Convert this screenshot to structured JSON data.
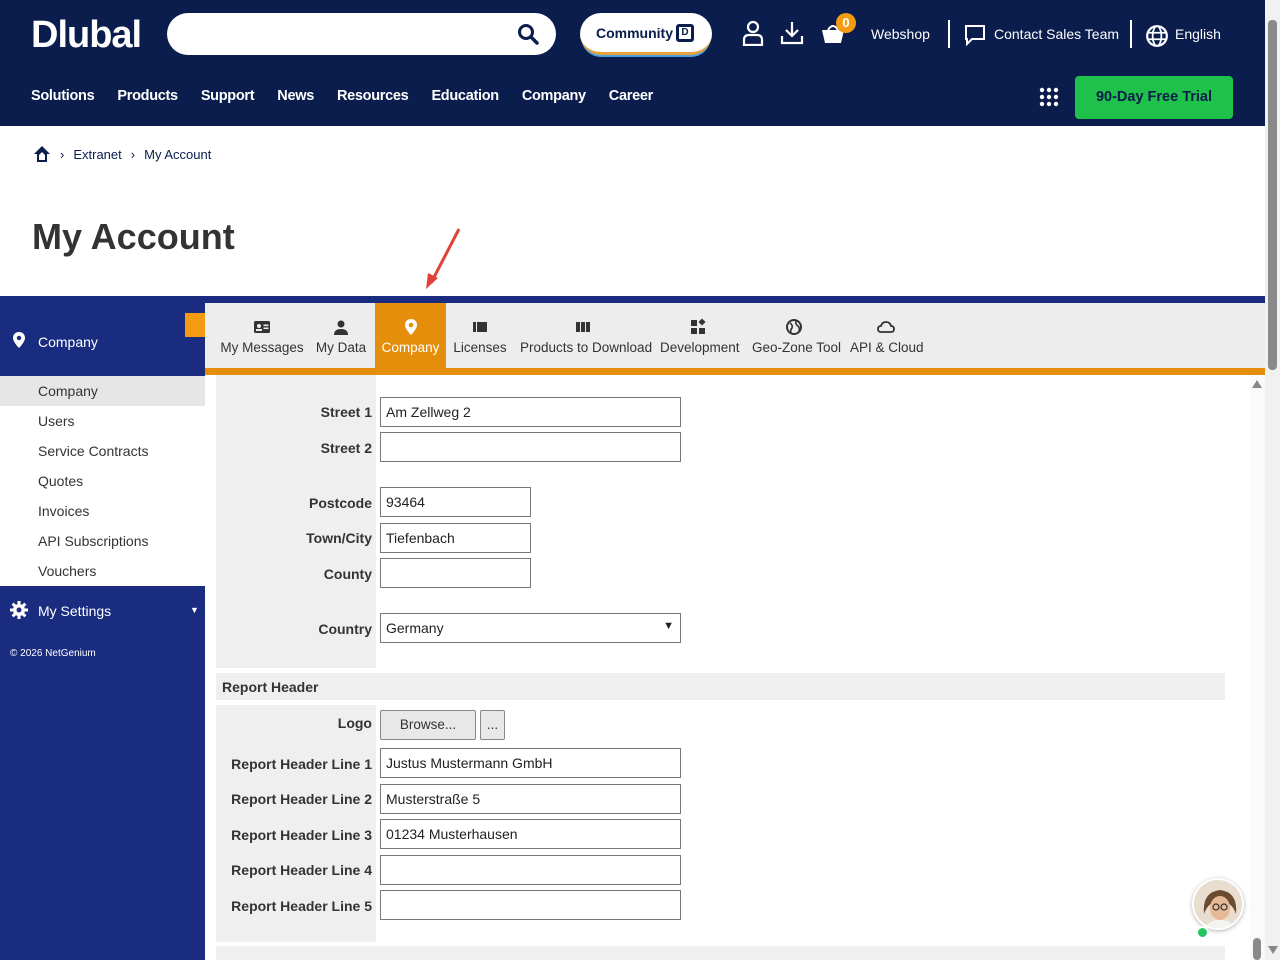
{
  "header": {
    "logo": "Dlubal",
    "search_placeholder": "",
    "community_label": "Community",
    "cart_count": "0",
    "webshop_label": "Webshop",
    "contact_label": "Contact Sales Team",
    "language_label": "English",
    "nav": [
      "Solutions",
      "Products",
      "Support",
      "News",
      "Resources",
      "Education",
      "Company",
      "Career"
    ],
    "trial_button": "90-Day Free Trial",
    "colors": {
      "header_bg": "#0b1d4d",
      "trial_bg": "#1ec24a",
      "accent": "#e58e0b"
    }
  },
  "breadcrumb": {
    "items": [
      "Extranet",
      "My Account"
    ]
  },
  "page_title": "My Account",
  "sidebar": {
    "section_title": "Company",
    "items": [
      {
        "label": "Company"
      },
      {
        "label": "Users"
      },
      {
        "label": "Service Contracts"
      },
      {
        "label": "Quotes"
      },
      {
        "label": "Invoices"
      },
      {
        "label": "API Subscriptions"
      },
      {
        "label": "Vouchers"
      }
    ],
    "settings_label": "My Settings",
    "copyright": "© 2026 NetGenium"
  },
  "tabs": [
    {
      "label": "My Messages",
      "icon": "id-card-icon"
    },
    {
      "label": "My Data",
      "icon": "user-icon"
    },
    {
      "label": "Company",
      "icon": "location-pin-icon"
    },
    {
      "label": "Licenses",
      "icon": "license-icon"
    },
    {
      "label": "Products to Download",
      "icon": "columns-icon"
    },
    {
      "label": "Development",
      "icon": "widgets-icon"
    },
    {
      "label": "Geo-Zone Tool",
      "icon": "globe-icon"
    },
    {
      "label": "API & Cloud",
      "icon": "cloud-icon"
    }
  ],
  "form": {
    "street1": {
      "label": "Street 1",
      "value": "Am Zellweg 2"
    },
    "street2": {
      "label": "Street 2",
      "value": ""
    },
    "postcode": {
      "label": "Postcode",
      "value": "93464"
    },
    "town": {
      "label": "Town/City",
      "value": "Tiefenbach"
    },
    "county": {
      "label": "County",
      "value": ""
    },
    "country": {
      "label": "Country",
      "value": "Germany"
    }
  },
  "report_header": {
    "title": "Report Header",
    "logo_label": "Logo",
    "browse_button": "Browse...",
    "more_button": "...",
    "lines": [
      {
        "label": "Report Header Line 1",
        "value": "Justus Mustermann GmbH"
      },
      {
        "label": "Report Header Line 2",
        "value": "Musterstraße 5"
      },
      {
        "label": "Report Header Line 3",
        "value": "01234 Musterhausen"
      },
      {
        "label": "Report Header Line 4",
        "value": ""
      },
      {
        "label": "Report Header Line 5",
        "value": ""
      }
    ]
  }
}
